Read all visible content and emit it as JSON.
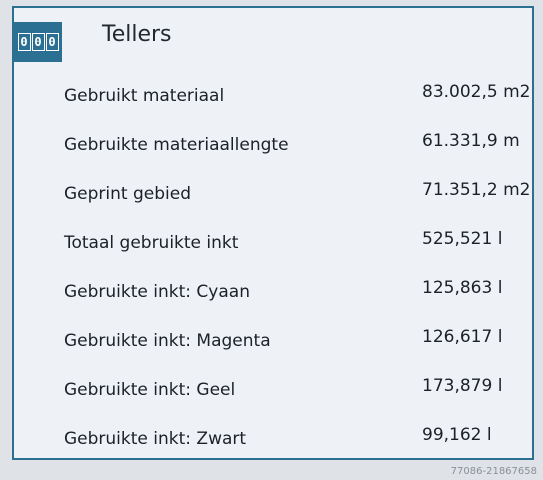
{
  "header": {
    "icon": "counter-icon",
    "icon_digits": [
      "0",
      "0",
      "0"
    ],
    "title": "Tellers"
  },
  "counters": [
    {
      "label": "Gebruikt materiaal",
      "value": "83.002,5 m2"
    },
    {
      "label": "Gebruikte materiaallengte",
      "value": "61.331,9 m"
    },
    {
      "label": "Geprint gebied",
      "value": "71.351,2 m2"
    },
    {
      "label": "Totaal gebruikte inkt",
      "value": "525,521 l"
    },
    {
      "label": "Gebruikte inkt: Cyaan",
      "value": "125,863 l"
    },
    {
      "label": "Gebruikte inkt: Magenta",
      "value": "126,617 l"
    },
    {
      "label": "Gebruikte inkt: Geel",
      "value": "173,879 l"
    },
    {
      "label": "Gebruikte inkt: Zwart",
      "value": "99,162 l"
    }
  ],
  "watermark": "77086-21867658",
  "colors": {
    "accent": "#2b6f93",
    "panel_background": "#eef1f5",
    "text": "#1c2128"
  }
}
